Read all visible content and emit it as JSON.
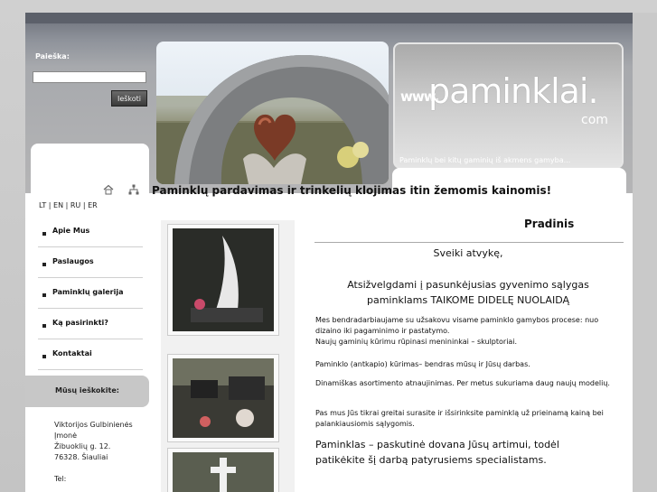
{
  "search": {
    "label": "Paieška:",
    "placeholder": "",
    "value": "",
    "button": "Ieškoti"
  },
  "logo": {
    "www": "www.",
    "main": "paminklai.",
    "com": "com"
  },
  "tagline": "Paminklų bei kitų gaminių iš akmens gamyba...",
  "promo": "Paminklų pardavimas ir trinkelių klojimas itin žemomis kainomis!",
  "languages": [
    {
      "label": "LT",
      "sep": " | "
    },
    {
      "label": "EN",
      "sep": " | "
    },
    {
      "label": "RU",
      "sep": " | "
    },
    {
      "label": "ER",
      "sep": ""
    }
  ],
  "nav": [
    {
      "label": "Apie Mus"
    },
    {
      "label": "Paslaugos"
    },
    {
      "label": "Paminklų galerija"
    },
    {
      "label": "Ką pasirinkti?"
    },
    {
      "label": "Kontaktai"
    }
  ],
  "sidebar": {
    "seek_title": "Mūsų ieškokite:",
    "address": [
      "Viktorijos Gulbinienės",
      "Įmonė",
      "Žibuoklių g. 12.",
      "76328. Šiauliai",
      "",
      "Tel:"
    ]
  },
  "content": {
    "title": "Pradinis",
    "welcome": "Sveiki atvykę,",
    "discount_line1": "Atsižvelgdami į pasunkėjusias gyvenimo sąlygas",
    "discount_line2": "paminklams  TAIKOME DIDELĘ NUOLAIDĄ",
    "p1_line1": "Mes bendradarbiaujame su užsakovu visame paminklo gamybos procese: nuo",
    "p1_line2": "dizaino iki pagaminimo ir pastatymo.",
    "p1_line3": "Naujų gaminių kūrimu rūpinasi menininkai – skulptoriai.",
    "p2": "Paminklo (antkapio) kūrimas– bendras mūsų ir Jūsų darbas.",
    "p3": "Dinamiškas asortimento atnaujinimas. Per metus sukuriama daug naujų modelių.",
    "p4_line1": "Pas mus Jūs tikrai greitai surasite ir išsirinksite paminklą už prieinamą kainą bei",
    "p4_line2": "palankiausiomis sąlygomis.",
    "closing_line1": "Paminklas – paskutinė dovana Jūsų artimui, todėl",
    "closing_line2": "patikėkite šį darbą patyrusiems specialistams."
  },
  "colors": {
    "header_dark": "#5c606a",
    "header_mid": "#a7a9ad",
    "seek_bg": "#c7c7c7"
  }
}
